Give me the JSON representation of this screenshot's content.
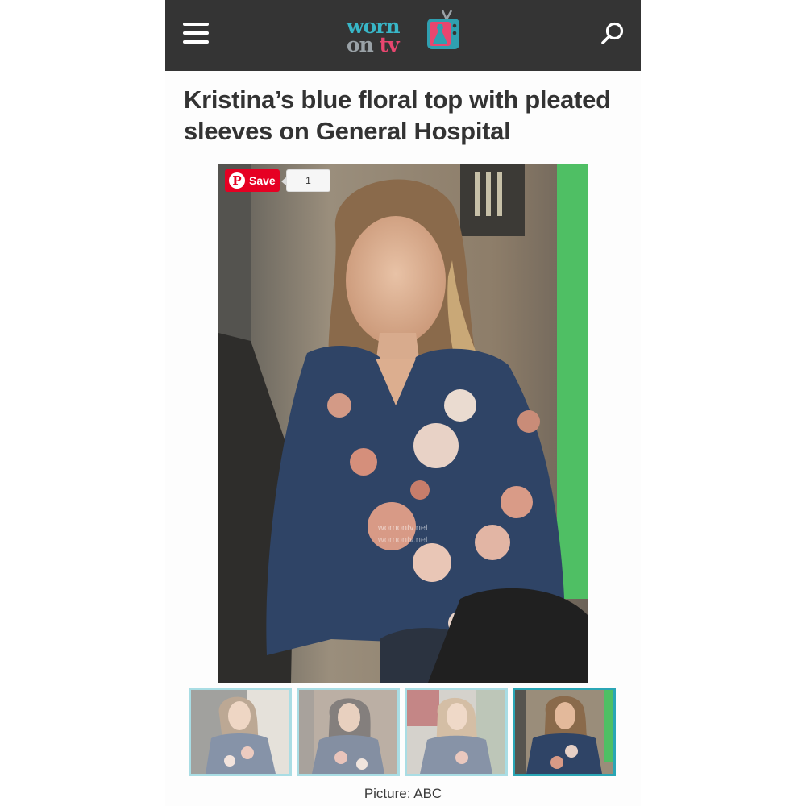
{
  "header": {
    "logo_line1": "worn",
    "logo_line2_a": "on ",
    "logo_line2_b": "tv",
    "colors": {
      "bar": "#343434",
      "logo_teal": "#38b6c7",
      "logo_pink": "#e8466f",
      "logo_grey": "#9aa2a7"
    }
  },
  "article": {
    "title": "Kristina’s blue floral top with pleated sleeves on General Hospital",
    "photo_credit": "Picture: ABC"
  },
  "pinterest": {
    "save_label": "Save",
    "save_count": "1",
    "color": "#e60023"
  },
  "photo": {
    "watermark": "wornontv.net"
  },
  "gallery": {
    "thumbnails": [
      {
        "active": false
      },
      {
        "active": false
      },
      {
        "active": false
      },
      {
        "active": true
      }
    ]
  }
}
